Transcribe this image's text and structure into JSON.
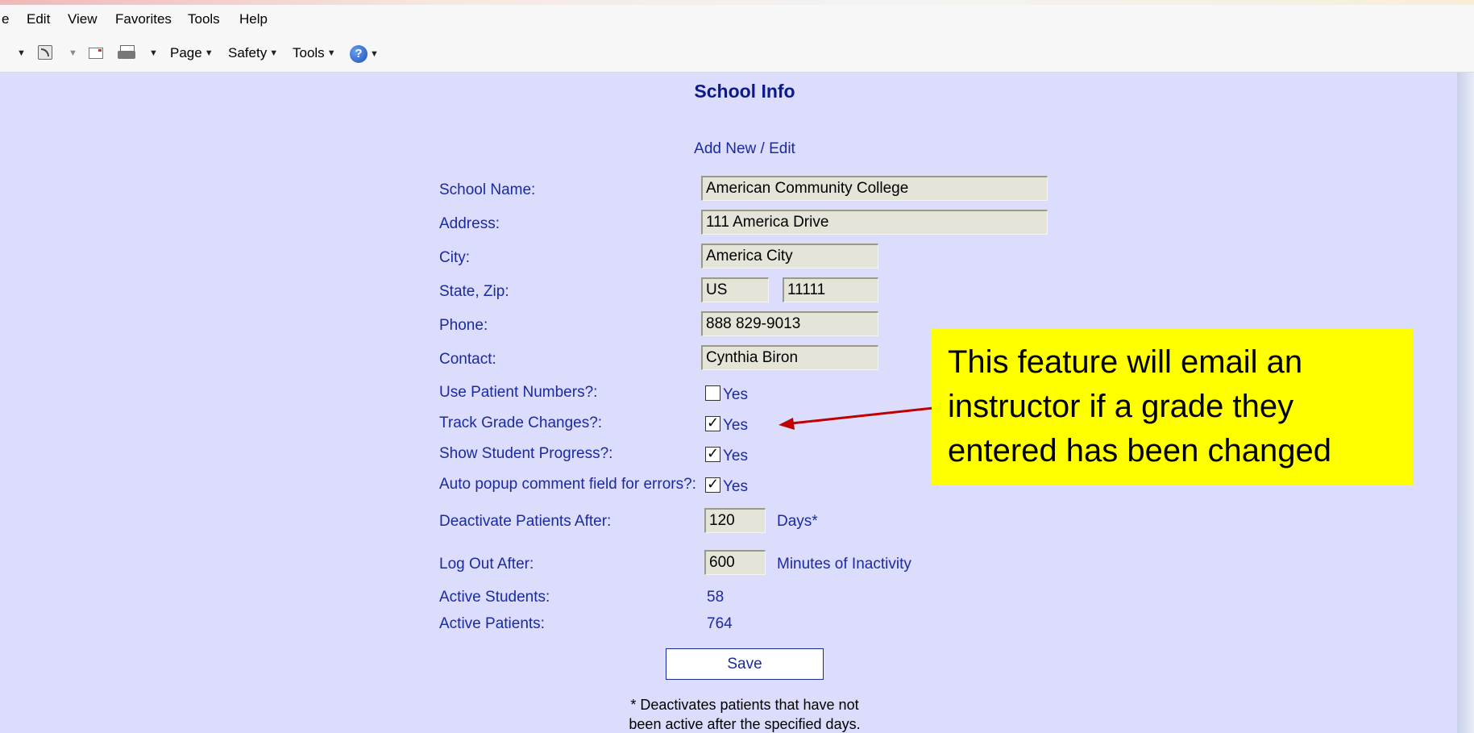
{
  "menubar": {
    "items": [
      "e",
      "Edit",
      "View",
      "Favorites",
      "Tools",
      "Help"
    ]
  },
  "toolbar": {
    "page_label": "Page",
    "safety_label": "Safety",
    "tools_label": "Tools",
    "help_glyph": "?",
    "icons": [
      "feeds-icon",
      "read-mail-icon",
      "print-icon",
      "help-icon"
    ]
  },
  "form": {
    "title": "School Info",
    "subtitle": "Add New / Edit",
    "labels": {
      "school_name": "School Name:",
      "address": "Address:",
      "city": "City:",
      "state_zip": "State, Zip:",
      "phone": "Phone:",
      "contact": "Contact:",
      "use_patient_numbers": "Use Patient Numbers?:",
      "track_grade_changes": "Track Grade Changes?:",
      "show_student_progress": "Show Student Progress?:",
      "auto_popup": "Auto popup comment field for errors?:",
      "deactivate_after": "Deactivate Patients After:",
      "log_out_after": "Log Out After:",
      "active_students": "Active Students:",
      "active_patients": "Active Patients:"
    },
    "values": {
      "school_name": "American Community College",
      "address": "111 America Drive",
      "city": "America City",
      "state": "US",
      "zip": "11111",
      "phone": "888 829-9013",
      "contact": "Cynthia Biron",
      "deactivate_days": "120",
      "log_out_minutes": "600",
      "active_students": "58",
      "active_patients": "764"
    },
    "checkboxes": {
      "use_patient_numbers": false,
      "track_grade_changes": true,
      "show_student_progress": true,
      "auto_popup": true
    },
    "yes_label": "Yes",
    "days_unit": "Days*",
    "minutes_unit": "Minutes of Inactivity",
    "save_label": "Save",
    "footnote_line1": "* Deactivates patients that have not",
    "footnote_line2": "been active after the specified days."
  },
  "callout": {
    "line1": "This feature will email an",
    "line2": "instructor if a grade they",
    "line3": "entered has been changed"
  },
  "colors": {
    "page_background": "#dcdcfc",
    "text": "#1a2aa0",
    "title": "#0a1a8a",
    "callout_background": "#ffff00",
    "arrow": "#c00000"
  }
}
